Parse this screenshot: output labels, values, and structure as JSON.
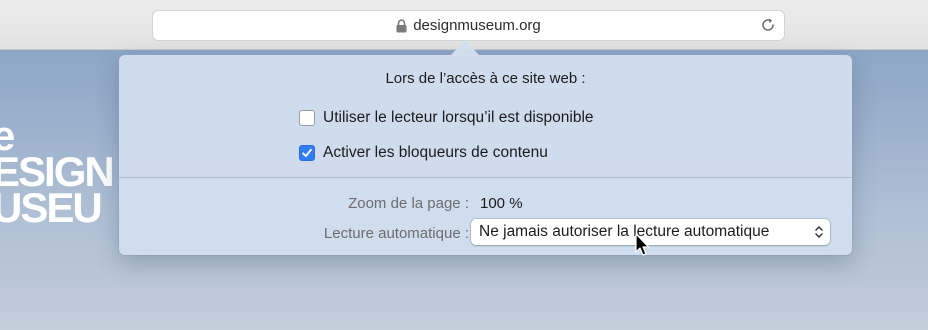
{
  "browser": {
    "url": "designmuseum.org"
  },
  "site_logo": {
    "lines": [
      "e",
      "ESIGN",
      "USEU"
    ]
  },
  "popover": {
    "title": "Lors de l’accès à ce site web :",
    "options": [
      {
        "label": "Utiliser le lecteur lorsqu’il est disponible",
        "checked": false
      },
      {
        "label": "Activer les bloqueurs de contenu",
        "checked": true
      }
    ],
    "zoom": {
      "label": "Zoom de la page :",
      "value": "100 %"
    },
    "autoplay": {
      "label": "Lecture automatique :",
      "value": "Ne jamais autoriser la lecture automatique"
    }
  },
  "colors": {
    "accent": "#2f7cf6"
  }
}
